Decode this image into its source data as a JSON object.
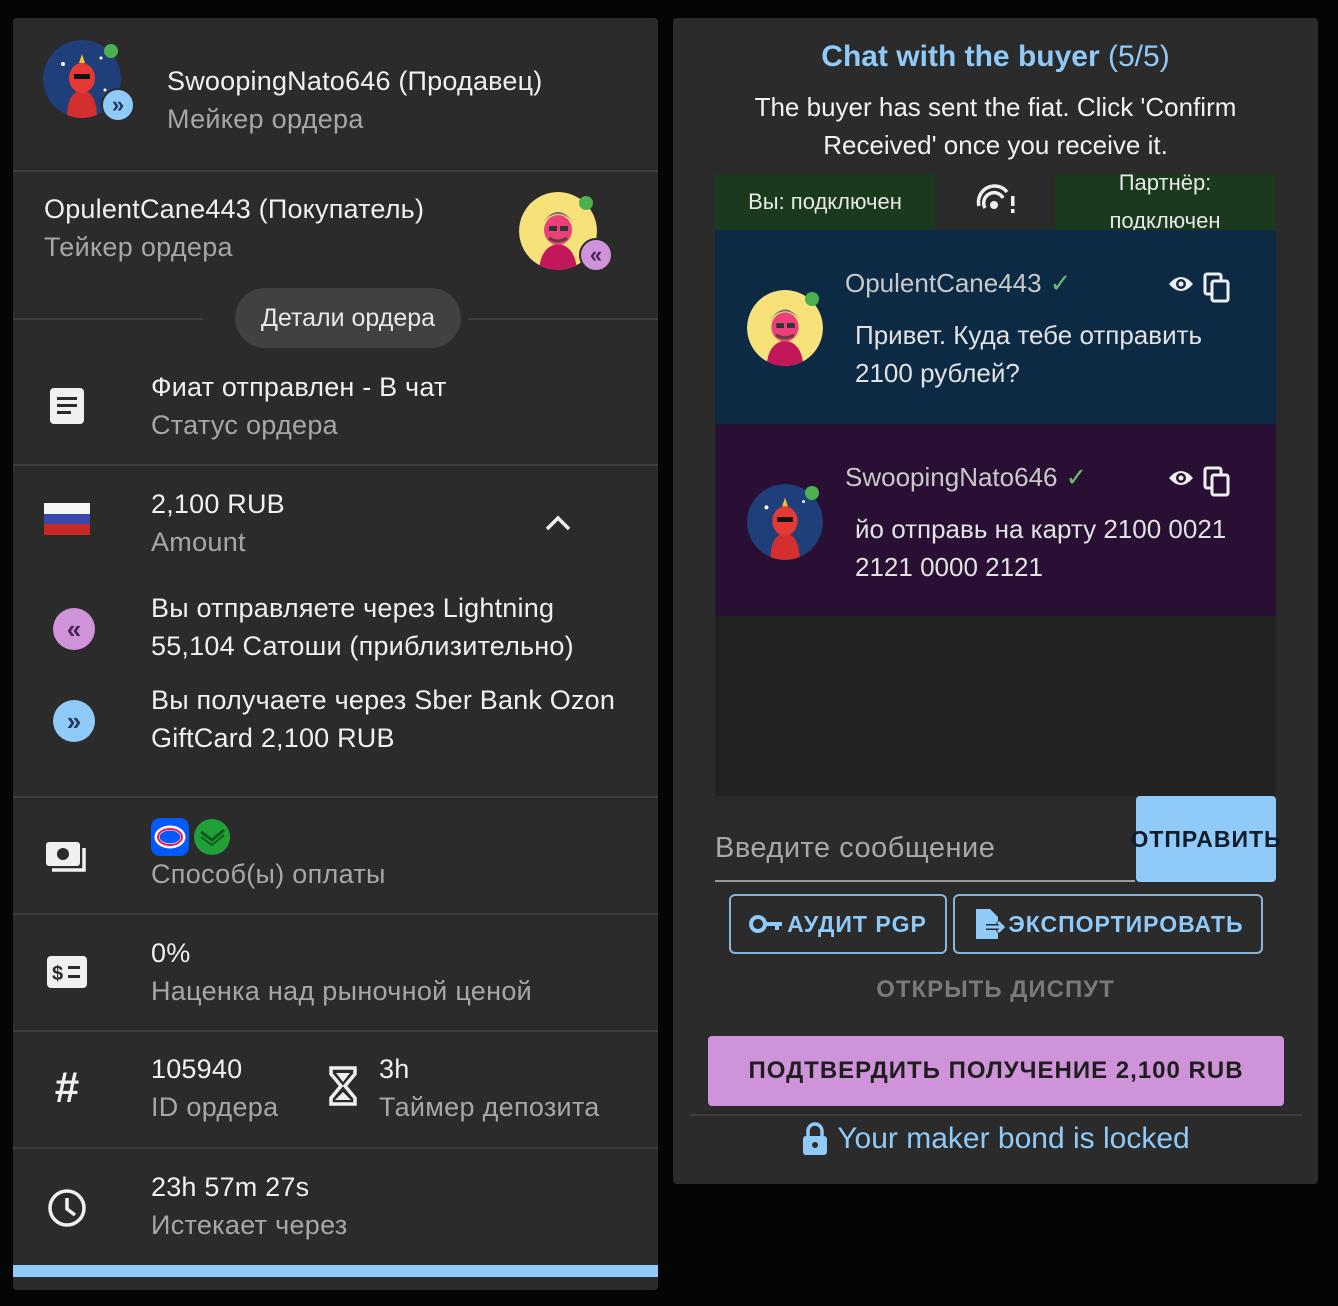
{
  "maker": {
    "name": "SwoopingNato646 (Продавец)",
    "role": "Мейкер ордера"
  },
  "taker": {
    "name": "OpulentCane443 (Покупатель)",
    "role": "Тейкер ордера"
  },
  "details_chip": "Детали ордера",
  "status": {
    "value": "Фиат отправлен - В чат",
    "label": "Статус ордера"
  },
  "amount": {
    "value": "2,100 RUB",
    "label": "Amount"
  },
  "send_via": {
    "line1": "Вы отправляете через Lightning",
    "line2": "55,104 Сатоши (приблизительно)"
  },
  "receive_via": {
    "line1": "Вы получаете через Sber Bank Ozon",
    "line2": "GiftCard 2,100 RUB"
  },
  "payment": {
    "label": "Способ(ы) оплаты"
  },
  "premium": {
    "value": "0%",
    "label": "Наценка над рыночной ценой"
  },
  "order_id": {
    "value": "105940",
    "label": "ID ордера"
  },
  "timer": {
    "value": "3h",
    "label": "Таймер депозита"
  },
  "expires": {
    "value": "23h 57m 27s",
    "label": "Истекает через"
  },
  "chat": {
    "title": "Chat with the buyer",
    "count": "(5/5)",
    "message": "The buyer has sent the fiat. Click 'Confirm Received' once you receive it.",
    "you_connected": "Вы: подключен",
    "partner_connected": "Партнёр: подключен",
    "messages": [
      {
        "user": "OpulentCane443",
        "text": "Привет. Куда тебе отправить 2100 рублей?"
      },
      {
        "user": "SwoopingNato646",
        "text": "йо отправь на карту 2100 0021 2121 0000 2121"
      }
    ],
    "input_placeholder": "Введите сообщение",
    "send_label": "ОТПРАВИТЬ",
    "audit_label": "АУДИТ PGP",
    "export_label": "ЭКСПОРТИРОВАТЬ",
    "dispute_label": "ОТКРЫТЬ ДИСПУТ",
    "confirm_label": "ПОДТВЕРДИТЬ ПОЛУЧЕНИЕ 2,100 RUB",
    "bond_text": "Your maker bond is locked"
  },
  "colors": {
    "accent_blue": "#90caf9",
    "accent_purple": "#ce93d8",
    "panel": "#2b2b2b",
    "buyer_msg": "#0d2a45",
    "seller_msg": "#2a0f35",
    "online": "#4caf50"
  }
}
